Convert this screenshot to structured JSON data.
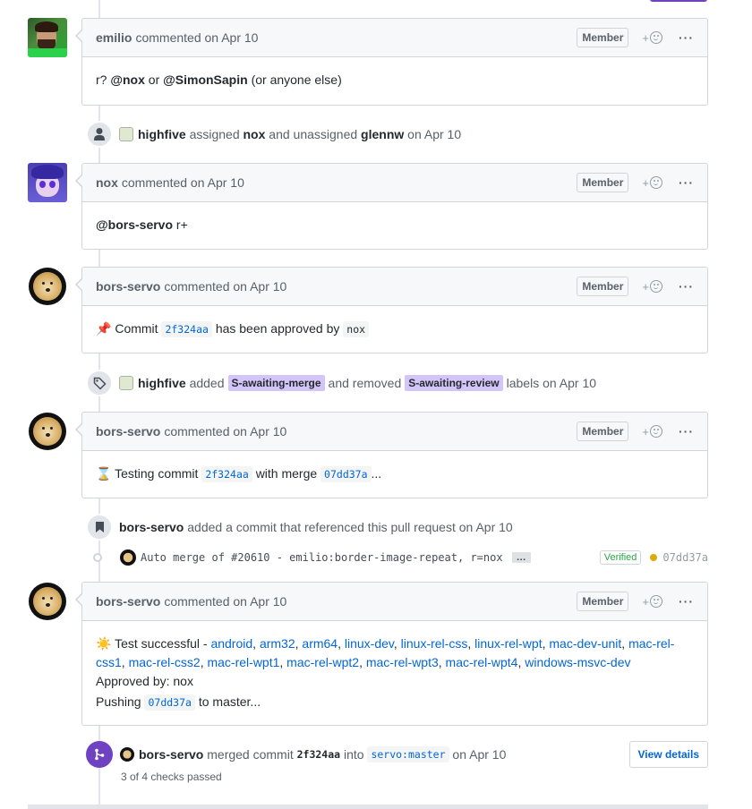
{
  "colors": {
    "link": "#0366d6",
    "label_bg": "#d4c5f9",
    "merged": "#6f42c1",
    "verified": "#28a745",
    "pending": "#dbab09"
  },
  "comments": [
    {
      "author": "emilio",
      "when": "commented on Apr 10",
      "badge": "Member",
      "body": {
        "prefix": "r?",
        "mention1": "@nox",
        "mid": "or",
        "mention2": "@SimonSapin",
        "suffix": "(or anyone else)"
      }
    },
    {
      "author": "nox",
      "when": "commented on Apr 10",
      "badge": "Member",
      "body": {
        "mention": "@bors-servo",
        "suffix": "r+"
      }
    },
    {
      "author": "bors-servo",
      "when": "commented on Apr 10",
      "badge": "Member",
      "body": {
        "emoji": "📌",
        "pre": "Commit",
        "commit": "2f324aa",
        "mid": "has been approved by",
        "user": "nox"
      }
    },
    {
      "author": "bors-servo",
      "when": "commented on Apr 10",
      "badge": "Member",
      "body": {
        "emoji": "⌛",
        "pre": "Testing commit",
        "commit": "2f324aa",
        "mid": "with merge",
        "merge": "07dd37a",
        "suffix": "..."
      }
    },
    {
      "author": "bors-servo",
      "when": "commented on Apr 10",
      "badge": "Member",
      "body": {
        "emoji": "☀️",
        "pre": "Test successful -",
        "builders": [
          "android",
          "arm32",
          "arm64",
          "linux-dev",
          "linux-rel-css",
          "linux-rel-wpt",
          "mac-dev-unit",
          "mac-rel-css1",
          "mac-rel-css2",
          "mac-rel-wpt1",
          "mac-rel-wpt2",
          "mac-rel-wpt3",
          "mac-rel-wpt4",
          "windows-msvc-dev"
        ],
        "approved": "Approved by: nox",
        "pushing_pre": "Pushing",
        "pushing_sha": "07dd37a",
        "pushing_post": "to master..."
      }
    }
  ],
  "events": {
    "assign": {
      "actor": "highfive",
      "verb1": "assigned",
      "user1": "nox",
      "verb2": "and unassigned",
      "user2": "glennw",
      "when": "on Apr 10",
      "icon": "person-icon"
    },
    "labels": {
      "actor": "highfive",
      "verb1": "added",
      "label1": "S-awaiting-merge",
      "verb2": "and removed",
      "label2": "S-awaiting-review",
      "tail": "labels on Apr 10",
      "icon": "tag-icon"
    },
    "commit_ref": {
      "actor": "bors-servo",
      "text": "added a commit that referenced this pull request on Apr 10",
      "icon": "bookmark-icon"
    },
    "commit": {
      "message": "Auto merge of #20610 - emilio:border-image-repeat, r=nox",
      "ellipsis": "…",
      "verified": "Verified",
      "sha": "07dd37a"
    },
    "merge": {
      "actor": "bors-servo",
      "verb": "merged commit",
      "sha": "2f324aa",
      "into": "into",
      "branch": "servo:master",
      "when": "on Apr 10",
      "checks": "3 of 4 checks passed",
      "button": "View details",
      "icon": "git-merge-icon"
    }
  },
  "reaction_plus": "+",
  "menu_dots": "···"
}
